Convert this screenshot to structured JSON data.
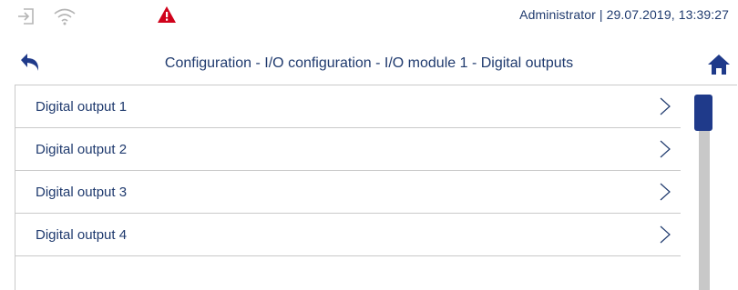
{
  "status_bar": {
    "icons": [
      "login-icon",
      "wifi-icon",
      "warning-icon"
    ],
    "user": "Administrator",
    "separator": "|",
    "datetime": "29.07.2019, 13:39:27",
    "user_datetime_text": "Administrator | 29.07.2019, 13:39:27",
    "warning_color": "#d0021b"
  },
  "header": {
    "title": "Configuration - I/O configuration - I/O module 1 - Digital outputs",
    "back_icon": "back-arrow-icon",
    "home_icon": "home-icon"
  },
  "list": {
    "items": [
      {
        "label": "Digital output 1"
      },
      {
        "label": "Digital output 2"
      },
      {
        "label": "Digital output 3"
      },
      {
        "label": "Digital output 4"
      }
    ]
  },
  "colors": {
    "accent": "#1f3a8a",
    "text": "#1f3a6e",
    "divider": "#c9c9c9",
    "scroll_track": "#c8c8c8"
  }
}
